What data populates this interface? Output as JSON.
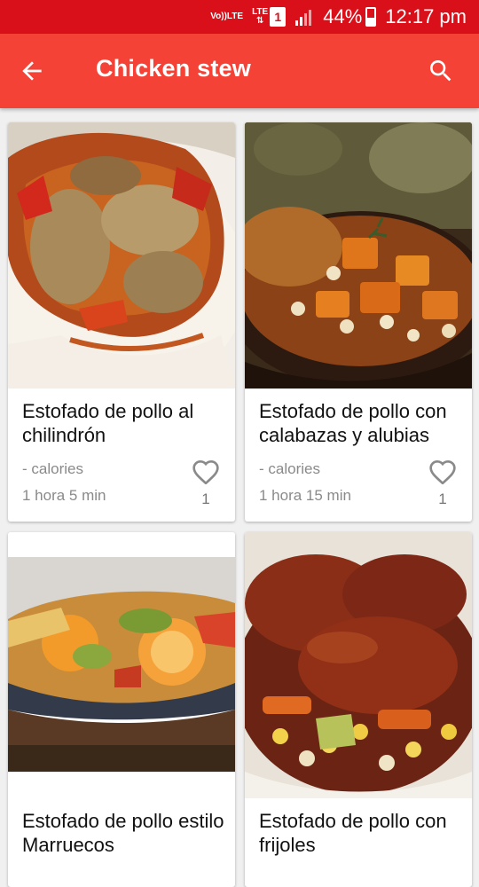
{
  "status_bar": {
    "volte": "Vo))",
    "volte_sub": "LTE",
    "network": "LTE",
    "sim": "1",
    "battery": "44%",
    "time": "12:17 pm"
  },
  "app_bar": {
    "title": "Chicken stew",
    "back_icon": "arrow-back-icon",
    "search_icon": "search-icon",
    "color": "#f44336"
  },
  "recipes": [
    {
      "name": "Estofado de pollo al chilindrón",
      "calories": "- calories",
      "time": "1 hora 5 min",
      "likes": "1"
    },
    {
      "name": "Estofado de pollo con calabazas y alubias",
      "calories": "- calories",
      "time": "1 hora 15 min",
      "likes": "1"
    },
    {
      "name": "Estofado de pollo estilo Marruecos",
      "calories": "",
      "time": "",
      "likes": ""
    },
    {
      "name": "Estofado de pollo con frijoles",
      "calories": "",
      "time": "",
      "likes": ""
    }
  ]
}
